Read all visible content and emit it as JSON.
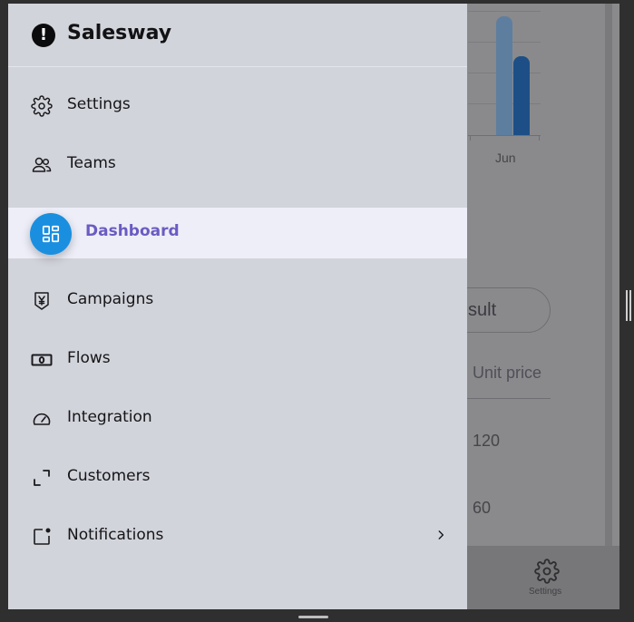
{
  "app": {
    "name": "Salesway"
  },
  "menu": {
    "items": [
      {
        "label": "Settings",
        "icon": "gear-icon"
      },
      {
        "label": "Teams",
        "icon": "users-icon"
      },
      {
        "label": "Dashboard",
        "icon": "grid-icon",
        "active": true
      },
      {
        "label": "Campaigns",
        "icon": "yen-shield-icon"
      },
      {
        "label": "Flows",
        "icon": "banknote-icon"
      },
      {
        "label": "Integration",
        "icon": "gauge-icon"
      },
      {
        "label": "Customers",
        "icon": "expand-corners-icon"
      },
      {
        "label": "Notifications",
        "icon": "notification-square-icon",
        "has_submenu": true
      }
    ]
  },
  "background": {
    "chart": {
      "type": "bar",
      "categories": [
        "Jun"
      ],
      "series": [
        {
          "values": [
            90
          ]
        },
        {
          "values": [
            60
          ]
        }
      ],
      "colors": [
        "#5e7ea0",
        "#1d4f86"
      ]
    },
    "result_button": "ll Result",
    "table": {
      "header": "Unit price",
      "rows": [
        "120",
        "60"
      ]
    },
    "bottom_nav": {
      "settings_label": "Settings"
    }
  },
  "colors": {
    "accent": "#1a8fe0",
    "active_text": "#6a5bc2",
    "drawer_bg": "#d2d4db",
    "active_bg": "#edeef8"
  }
}
